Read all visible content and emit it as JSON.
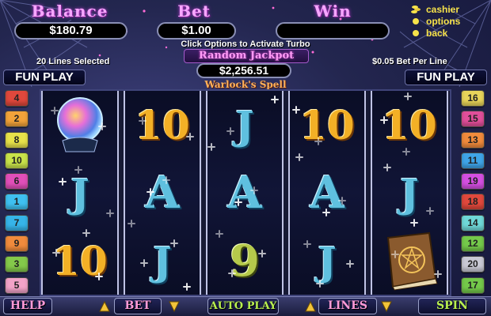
{
  "header": {
    "balance_label": "Balance",
    "balance_value": "$180.79",
    "bet_label": "Bet",
    "bet_value": "$1.00",
    "win_label": "Win",
    "win_value": ""
  },
  "menu": [
    {
      "label": "cashier",
      "icon": "coins-icon"
    },
    {
      "label": "options",
      "icon": "dot-icon"
    },
    {
      "label": "back",
      "icon": "dot-icon"
    }
  ],
  "info": {
    "turbo_hint": "Click Options to Activate Turbo Play",
    "lines_selected": "20 Lines Selected",
    "bet_per_line": "$0.05 Bet Per Line"
  },
  "jackpot": {
    "label": "Random Jackpot",
    "value": "$2,256.51"
  },
  "game_title": "Warlock's Spell",
  "fun_play_left": "FUN PLAY",
  "fun_play_right": "FUN PLAY",
  "lines_left": [
    {
      "n": "4",
      "color": "#e0483c"
    },
    {
      "n": "2",
      "color": "#f2a33a"
    },
    {
      "n": "8",
      "color": "#e8e24a"
    },
    {
      "n": "10",
      "color": "#c8e24a"
    },
    {
      "n": "6",
      "color": "#e14fb9"
    },
    {
      "n": "1",
      "color": "#3fc0f0"
    },
    {
      "n": "7",
      "color": "#36b4e8"
    },
    {
      "n": "9",
      "color": "#f08b3c"
    },
    {
      "n": "3",
      "color": "#84c94a"
    },
    {
      "n": "5",
      "color": "#f2a3c8"
    }
  ],
  "lines_right": [
    {
      "n": "16",
      "color": "#e8d45a"
    },
    {
      "n": "15",
      "color": "#e14f9a"
    },
    {
      "n": "13",
      "color": "#f08b3c"
    },
    {
      "n": "11",
      "color": "#3fa4e8"
    },
    {
      "n": "19",
      "color": "#d44fe1"
    },
    {
      "n": "18",
      "color": "#e0483c"
    },
    {
      "n": "14",
      "color": "#6fd8d8"
    },
    {
      "n": "12",
      "color": "#74c94a"
    },
    {
      "n": "20",
      "color": "#c9c9d4"
    },
    {
      "n": "17",
      "color": "#74c94a"
    }
  ],
  "reels": [
    [
      {
        "sym": "crystal-ball",
        "text": ""
      },
      {
        "sym": "J",
        "text": "J"
      },
      {
        "sym": "10",
        "text": "10"
      }
    ],
    [
      {
        "sym": "10",
        "text": "10"
      },
      {
        "sym": "A",
        "text": "A"
      },
      {
        "sym": "J",
        "text": "J"
      }
    ],
    [
      {
        "sym": "J",
        "text": "J"
      },
      {
        "sym": "A",
        "text": "A"
      },
      {
        "sym": "9",
        "text": "9"
      }
    ],
    [
      {
        "sym": "10",
        "text": "10"
      },
      {
        "sym": "A",
        "text": "A"
      },
      {
        "sym": "J",
        "text": "J"
      }
    ],
    [
      {
        "sym": "10",
        "text": "10"
      },
      {
        "sym": "J",
        "text": "J"
      },
      {
        "sym": "spellbook",
        "text": ""
      }
    ]
  ],
  "bottom": {
    "help": "HELP",
    "bet": "BET",
    "autoplay": "AUTO PLAY",
    "lines": "LINES",
    "spin": "SPIN"
  }
}
